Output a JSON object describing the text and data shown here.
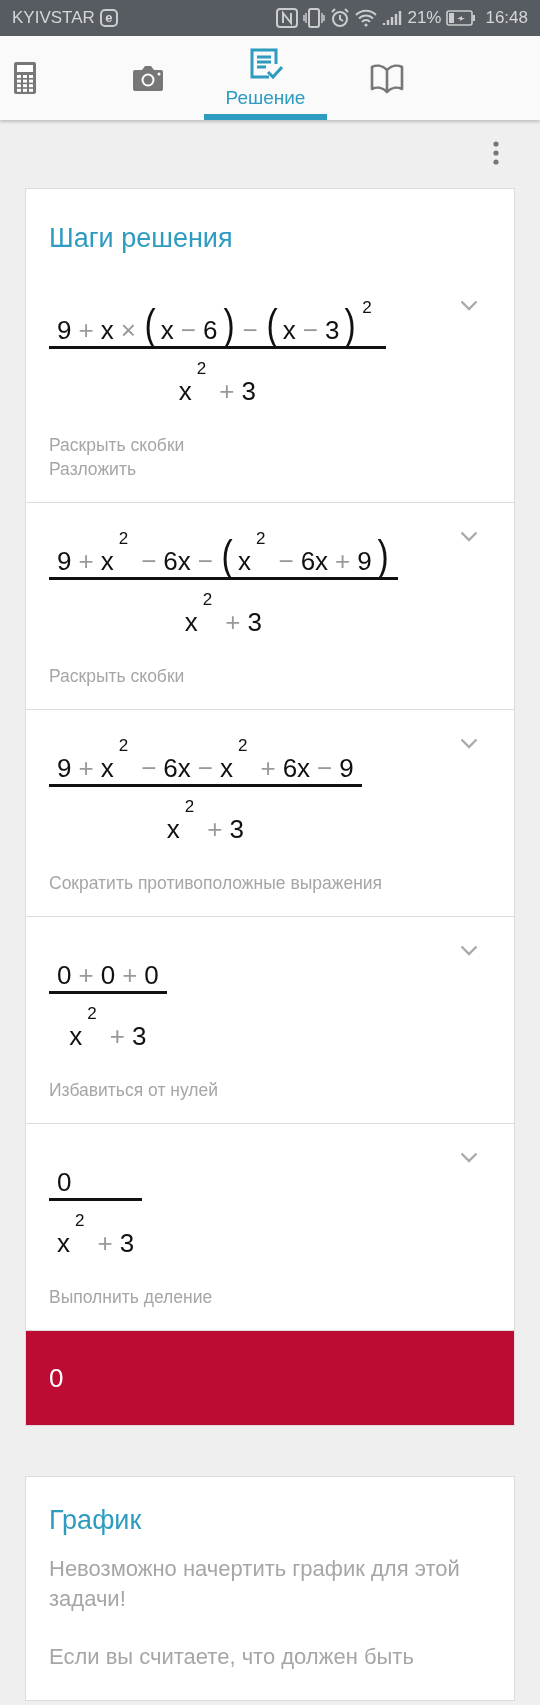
{
  "status_bar": {
    "carrier": "KYIVSTAR",
    "carrier_badge": "e",
    "battery_percent": "21%",
    "time": "16:48"
  },
  "tabs": [
    {
      "kind": "calculator",
      "selected": false
    },
    {
      "kind": "camera",
      "selected": false
    },
    {
      "kind": "solution",
      "label": "Решение",
      "selected": true
    },
    {
      "kind": "book",
      "selected": false
    }
  ],
  "steps_card": {
    "title": "Шаги решения",
    "steps": [
      {
        "numerator": [
          {
            "text": "9",
            "kind": "n"
          },
          {
            "text": "+",
            "kind": "o"
          },
          {
            "text": "x",
            "kind": "n"
          },
          {
            "text": "×",
            "kind": "o"
          },
          {
            "text": "(",
            "kind": "p"
          },
          {
            "text": "x",
            "kind": "n"
          },
          {
            "text": "−",
            "kind": "o"
          },
          {
            "text": "6",
            "kind": "n"
          },
          {
            "text": ")",
            "kind": "p"
          },
          {
            "text": "−",
            "kind": "o"
          },
          {
            "text": "(",
            "kind": "p"
          },
          {
            "text": "x",
            "kind": "n"
          },
          {
            "text": "−",
            "kind": "o"
          },
          {
            "text": "3",
            "kind": "n"
          },
          {
            "text": ")",
            "kind": "p"
          },
          {
            "text": "2",
            "kind": "s"
          }
        ],
        "denominator": [
          {
            "text": "x",
            "kind": "n"
          },
          {
            "text": "2",
            "kind": "s"
          },
          {
            "text": "+",
            "kind": "o"
          },
          {
            "text": "3",
            "kind": "n"
          }
        ],
        "descriptions": [
          "Раскрыть скобки",
          "Разложить"
        ]
      },
      {
        "numerator": [
          {
            "text": "9",
            "kind": "n"
          },
          {
            "text": "+",
            "kind": "o"
          },
          {
            "text": "x",
            "kind": "n"
          },
          {
            "text": "2",
            "kind": "s"
          },
          {
            "text": "−",
            "kind": "o"
          },
          {
            "text": "6x",
            "kind": "n"
          },
          {
            "text": "−",
            "kind": "o"
          },
          {
            "text": "(",
            "kind": "p"
          },
          {
            "text": "x",
            "kind": "n"
          },
          {
            "text": "2",
            "kind": "s"
          },
          {
            "text": "−",
            "kind": "o"
          },
          {
            "text": "6x",
            "kind": "n"
          },
          {
            "text": "+",
            "kind": "o"
          },
          {
            "text": "9",
            "kind": "n"
          },
          {
            "text": ")",
            "kind": "p"
          }
        ],
        "denominator": [
          {
            "text": "x",
            "kind": "n"
          },
          {
            "text": "2",
            "kind": "s"
          },
          {
            "text": "+",
            "kind": "o"
          },
          {
            "text": "3",
            "kind": "n"
          }
        ],
        "descriptions": [
          "Раскрыть скобки"
        ]
      },
      {
        "numerator": [
          {
            "text": "9",
            "kind": "n"
          },
          {
            "text": "+",
            "kind": "o"
          },
          {
            "text": "x",
            "kind": "n"
          },
          {
            "text": "2",
            "kind": "s"
          },
          {
            "text": "−",
            "kind": "o"
          },
          {
            "text": "6x",
            "kind": "n"
          },
          {
            "text": "−",
            "kind": "o"
          },
          {
            "text": "x",
            "kind": "n"
          },
          {
            "text": "2",
            "kind": "s"
          },
          {
            "text": "+",
            "kind": "o"
          },
          {
            "text": "6x",
            "kind": "n"
          },
          {
            "text": "−",
            "kind": "o"
          },
          {
            "text": "9",
            "kind": "n"
          }
        ],
        "denominator": [
          {
            "text": "x",
            "kind": "n"
          },
          {
            "text": "2",
            "kind": "s"
          },
          {
            "text": "+",
            "kind": "o"
          },
          {
            "text": "3",
            "kind": "n"
          }
        ],
        "descriptions": [
          "Сократить противоположные выражения"
        ]
      },
      {
        "numerator": [
          {
            "text": "0",
            "kind": "n"
          },
          {
            "text": "+",
            "kind": "o"
          },
          {
            "text": "0",
            "kind": "n"
          },
          {
            "text": "+",
            "kind": "o"
          },
          {
            "text": "0",
            "kind": "n"
          }
        ],
        "denominator": [
          {
            "text": "x",
            "kind": "n"
          },
          {
            "text": "2",
            "kind": "s"
          },
          {
            "text": "+",
            "kind": "o"
          },
          {
            "text": "3",
            "kind": "n"
          }
        ],
        "descriptions": [
          "Избавиться от нулей"
        ]
      },
      {
        "numerator": [
          {
            "text": "0",
            "kind": "n"
          }
        ],
        "denominator": [
          {
            "text": "x",
            "kind": "n"
          },
          {
            "text": "2",
            "kind": "s"
          },
          {
            "text": "+",
            "kind": "o"
          },
          {
            "text": "3",
            "kind": "n"
          }
        ],
        "descriptions": [
          "Выполнить деление"
        ]
      }
    ],
    "result": "0"
  },
  "graph_card": {
    "title": "График",
    "message": "Невозможно начертить график для этой задачи!",
    "report_text": "Если вы считаете, что должен быть"
  }
}
